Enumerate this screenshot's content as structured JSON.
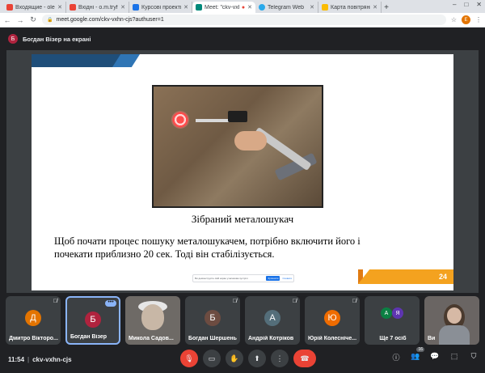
{
  "browser": {
    "tabs": [
      {
        "label": "Входящие - olenat",
        "color": "#ea4335"
      },
      {
        "label": "Вхідні - o.m.tryfon",
        "color": "#ea4335"
      },
      {
        "label": "Курсові проекти К",
        "color": "#1a73e8"
      },
      {
        "label": "Meet: \"ckv-vxhn",
        "color": "#00897b",
        "active": true
      },
      {
        "label": "Telegram Web",
        "color": "#29a9eb"
      },
      {
        "label": "Карта повітряних",
        "color": "#fbbc04"
      }
    ],
    "new_tab": "+",
    "window_controls": {
      "minimize": "–",
      "maximize": "□",
      "close": "✕"
    },
    "url": "meet.google.com/ckv-vxhn-cjs?authuser=1",
    "profile_initial": "Е"
  },
  "presenter": {
    "initial": "Б",
    "text": "Богдан Візер на екрані",
    "avatar_color": "#b0233e"
  },
  "slide": {
    "caption": "Зібраний металошукач",
    "body": "Щоб почати процес пошуку металошукачем, потрібно включити його і почекати приблизно 20 сек. Тоді він стабілізується.",
    "page_number": "24",
    "control_strip": {
      "text": "Ви демонструєте свій екран учасникам зустрічі",
      "stop": "Зупинити",
      "hide": "Сховати"
    }
  },
  "participants": [
    {
      "initial": "Д",
      "name": "Дмитро Вікторо...",
      "color": "#e37400",
      "muted": true
    },
    {
      "initial": "Б",
      "name": "Богдан Візер",
      "color": "#b0233e",
      "pinned": true
    },
    {
      "name": "Микола Садов...",
      "video": true
    },
    {
      "initial": "Б",
      "name": "Богдан Шершень",
      "color": "#6d4c41",
      "muted": true
    },
    {
      "initial": "А",
      "name": "Андрій Котріков",
      "color": "#546e7a",
      "muted": true
    },
    {
      "initial": "Ю",
      "name": "Юрій Колесніче...",
      "color": "#ef6c00",
      "muted": true
    },
    {
      "name": "Ще 7 осіб",
      "mini": [
        "А",
        "Я"
      ],
      "mini_colors": [
        "#0b8043",
        "#5e35b1"
      ]
    },
    {
      "name": "Ви",
      "video": true,
      "self": true
    }
  ],
  "bottom": {
    "time": "11:54",
    "separator": "|",
    "meeting_code": "ckv-vxhn-cjs",
    "people_count": "16"
  },
  "icons": {
    "back": "←",
    "forward": "→",
    "reload": "↻",
    "lock": "🔒",
    "star": "☆",
    "ext": "⋮",
    "mic_off": "🎙",
    "more": "•••",
    "mic": "🎤",
    "cam": "▭",
    "hand": "✋",
    "present": "⬆",
    "dots": "⋮",
    "end": "☎",
    "info": "ⓘ",
    "people": "👥",
    "chat": "💬",
    "activities": "⬚",
    "host": "⛉",
    "close": "✕"
  }
}
